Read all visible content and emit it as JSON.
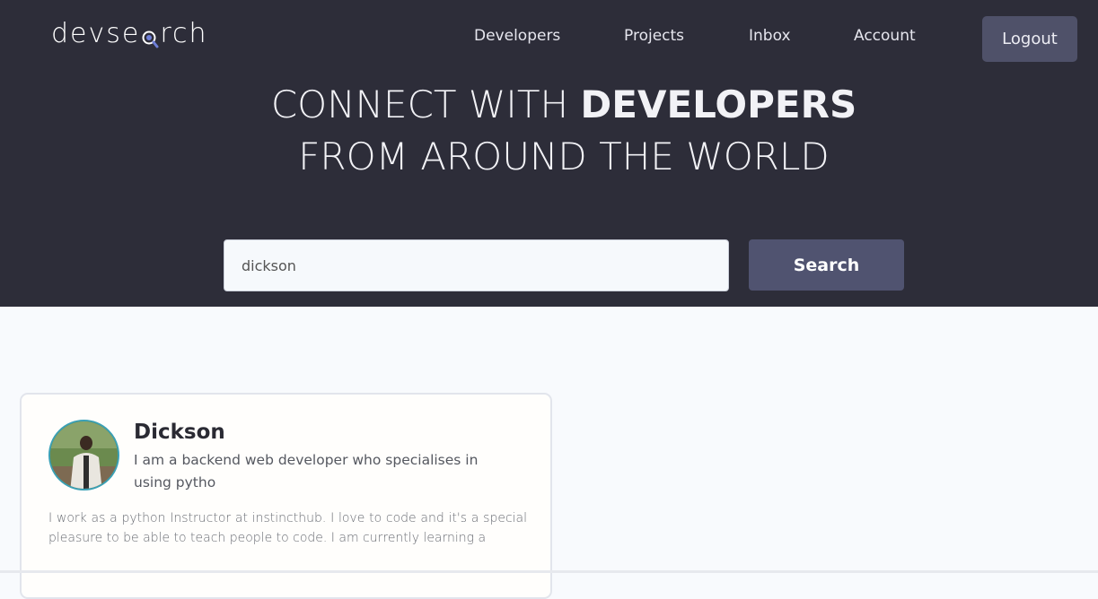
{
  "header": {
    "logo_text_1": "devse",
    "logo_text_2": "rch",
    "nav": [
      "Developers",
      "Projects",
      "Inbox",
      "Account"
    ],
    "logout_label": "Logout"
  },
  "hero": {
    "line1_light": "CONNECT WITH ",
    "line1_bold": "DEVELOPERS",
    "line2": "FROM AROUND THE WORLD"
  },
  "search": {
    "value": "dickson",
    "button_label": "Search"
  },
  "results": [
    {
      "name": "Dickson",
      "headline": "I am a backend web developer who specialises in using pytho",
      "bio": "I work as a python Instructor at instincthub. I love to code and it's a special pleasure to be able to teach people to code. I am currently learning a"
    }
  ]
}
